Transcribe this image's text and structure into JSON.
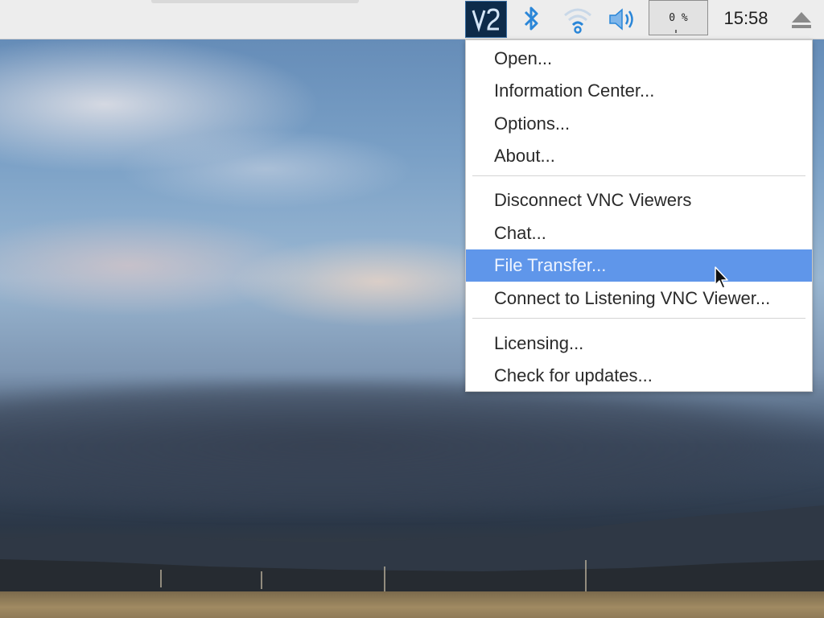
{
  "panel": {
    "tray": [
      {
        "name": "vnc-server-icon",
        "label": "V2"
      },
      {
        "name": "bluetooth-icon"
      },
      {
        "name": "wifi-icon"
      },
      {
        "name": "volume-icon"
      }
    ],
    "cpu_usage": "0 %",
    "clock": "15:58",
    "eject": "eject-icon"
  },
  "menu": {
    "items": [
      {
        "label": "Open..."
      },
      {
        "label": "Information Center..."
      },
      {
        "label": "Options..."
      },
      {
        "label": "About..."
      },
      {
        "label": "Disconnect VNC Viewers"
      },
      {
        "label": "Chat..."
      },
      {
        "label": "File Transfer...",
        "highlighted": true
      },
      {
        "label": "Connect to Listening VNC Viewer..."
      },
      {
        "label": "Licensing..."
      },
      {
        "label": "Check for updates..."
      }
    ]
  },
  "colors": {
    "highlight": "#5f96ea",
    "vnc_icon_bg": "#0d2b4a",
    "tray_blue": "#2a86d8"
  }
}
